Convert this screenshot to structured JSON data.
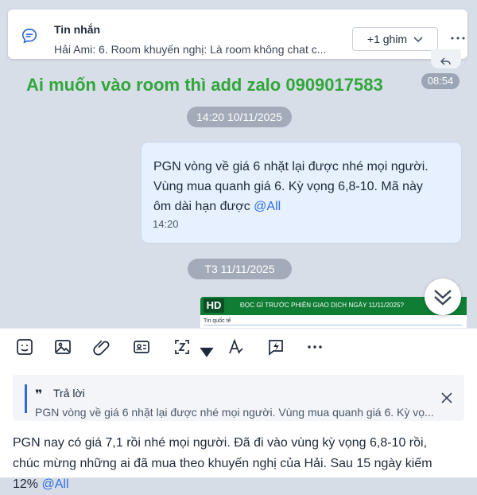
{
  "pinned": {
    "title": "Tin nhắn",
    "text": "Hải Ami: 6. Room khuyến nghị: Là room không chat c...",
    "button": "+1 ghim"
  },
  "notice": {
    "text": "Ai muốn vào room thì add zalo 0909017583",
    "time": "08:54"
  },
  "dates": {
    "first": "14:20 10/11/2025",
    "second": "T3 11/11/2025"
  },
  "message": {
    "line1": "PGN vòng về giá 6 nhặt lại được nhé mọi người.",
    "line2": "Vùng mua quanh giá 6. Kỳ vọng 6,8-10. Mã này",
    "line3_prefix": "ôm dài hạn được ",
    "mention": "@All",
    "time": "14:20"
  },
  "preview": {
    "badge": "HD",
    "title": "ĐỌC GÌ TRƯỚC PHIÊN GIAO DỊCH NGÀY 11/11/2025?",
    "subtitle": "Tin quốc tế"
  },
  "reply": {
    "quote": "❞",
    "label": "Trả lời",
    "preview": "PGN vòng về giá 6 nhặt lại được nhé mọi người. Vùng mua quanh giá 6. Kỳ vọ..."
  },
  "composer": {
    "line1": "PGN nay có giá 7,1 rồi nhé mọi người. Đã đi vào vùng kỳ vọng 6,8-10 rồi,",
    "line2": "chúc mừng những ai đã mua theo khuyến nghị của Hải. Sau 15 ngày kiếm",
    "line3_prefix": "12% ",
    "mention": "@All"
  },
  "icons": [
    "chat-bubble-icon",
    "chevron-down-icon",
    "more-horizontal-icon",
    "reply-arrow-icon",
    "double-chevron-down-icon",
    "sticker-icon",
    "image-icon",
    "attachment-icon",
    "contact-card-icon",
    "crop-frame-icon",
    "text-format-icon",
    "lightning-message-icon",
    "close-icon"
  ],
  "colors": {
    "green_notice": "#31a63a",
    "chat_background": "#d8dee8",
    "message_bubble": "#e6f0ff",
    "mention": "#2f6fe0",
    "accent": "#2d6bd3",
    "preview_green": "#0f7d34"
  }
}
